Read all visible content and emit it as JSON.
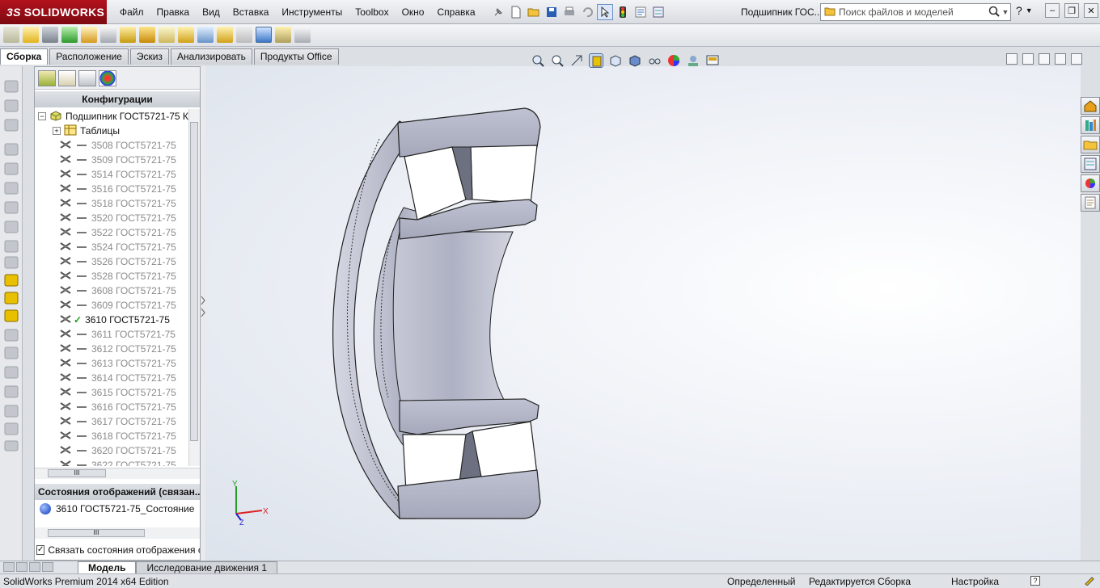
{
  "app": {
    "logo_text": "SOLIDWORKS",
    "logo_prefix": "3S",
    "document_title": "Подшипник ГОС...",
    "search_placeholder": "Поиск файлов и моделей"
  },
  "menu": [
    "Файл",
    "Правка",
    "Вид",
    "Вставка",
    "Инструменты",
    "Toolbox",
    "Окно",
    "Справка"
  ],
  "command_tabs": [
    {
      "label": "Сборка",
      "active": true
    },
    {
      "label": "Расположение",
      "active": false
    },
    {
      "label": "Эскиз",
      "active": false
    },
    {
      "label": "Анализировать",
      "active": false
    },
    {
      "label": "Продукты Office",
      "active": false
    }
  ],
  "config_panel": {
    "header": "Конфигурации",
    "root_label": "Подшипник ГОСТ5721-75 К",
    "tables_label": "Таблицы",
    "configurations": [
      {
        "label": "3508 ГОСТ5721-75",
        "active": false
      },
      {
        "label": "3509 ГОСТ5721-75",
        "active": false
      },
      {
        "label": "3514 ГОСТ5721-75",
        "active": false
      },
      {
        "label": "3516 ГОСТ5721-75",
        "active": false
      },
      {
        "label": "3518 ГОСТ5721-75",
        "active": false
      },
      {
        "label": "3520 ГОСТ5721-75",
        "active": false
      },
      {
        "label": "3522 ГОСТ5721-75",
        "active": false
      },
      {
        "label": "3524 ГОСТ5721-75",
        "active": false
      },
      {
        "label": "3526 ГОСТ5721-75",
        "active": false
      },
      {
        "label": "3528 ГОСТ5721-75",
        "active": false
      },
      {
        "label": "3608 ГОСТ5721-75",
        "active": false
      },
      {
        "label": "3609 ГОСТ5721-75",
        "active": false
      },
      {
        "label": "3610 ГОСТ5721-75",
        "active": true
      },
      {
        "label": "3611 ГОСТ5721-75",
        "active": false
      },
      {
        "label": "3612 ГОСТ5721-75",
        "active": false
      },
      {
        "label": "3613 ГОСТ5721-75",
        "active": false
      },
      {
        "label": "3614 ГОСТ5721-75",
        "active": false
      },
      {
        "label": "3615 ГОСТ5721-75",
        "active": false
      },
      {
        "label": "3616 ГОСТ5721-75",
        "active": false
      },
      {
        "label": "3617 ГОСТ5721-75",
        "active": false
      },
      {
        "label": "3618 ГОСТ5721-75",
        "active": false
      },
      {
        "label": "3620 ГОСТ5721-75",
        "active": false
      },
      {
        "label": "3622 ГОСТ5721-75",
        "active": false
      }
    ],
    "display_states_header": "Состояния отображений (связан...",
    "display_state_item": "3610 ГОСТ5721-75_Состояние",
    "link_display_states_label": "Связать состояния отображения с",
    "link_display_states_checked": true,
    "scroll_grip": "III"
  },
  "triad": {
    "x": "X",
    "y": "Y",
    "z": "Z"
  },
  "bottom_tabs": [
    {
      "label": "Модель",
      "active": true
    },
    {
      "label": "Исследование движения 1",
      "active": false
    }
  ],
  "status_bar": {
    "edition": "SolidWorks Premium 2014 x64 Edition",
    "state": "Определенный",
    "editing": "Редактируется Сборка",
    "settings": "Настройка"
  },
  "colors": {
    "brand_red": "#a4121a",
    "part_steel": "#b3b6c8"
  }
}
